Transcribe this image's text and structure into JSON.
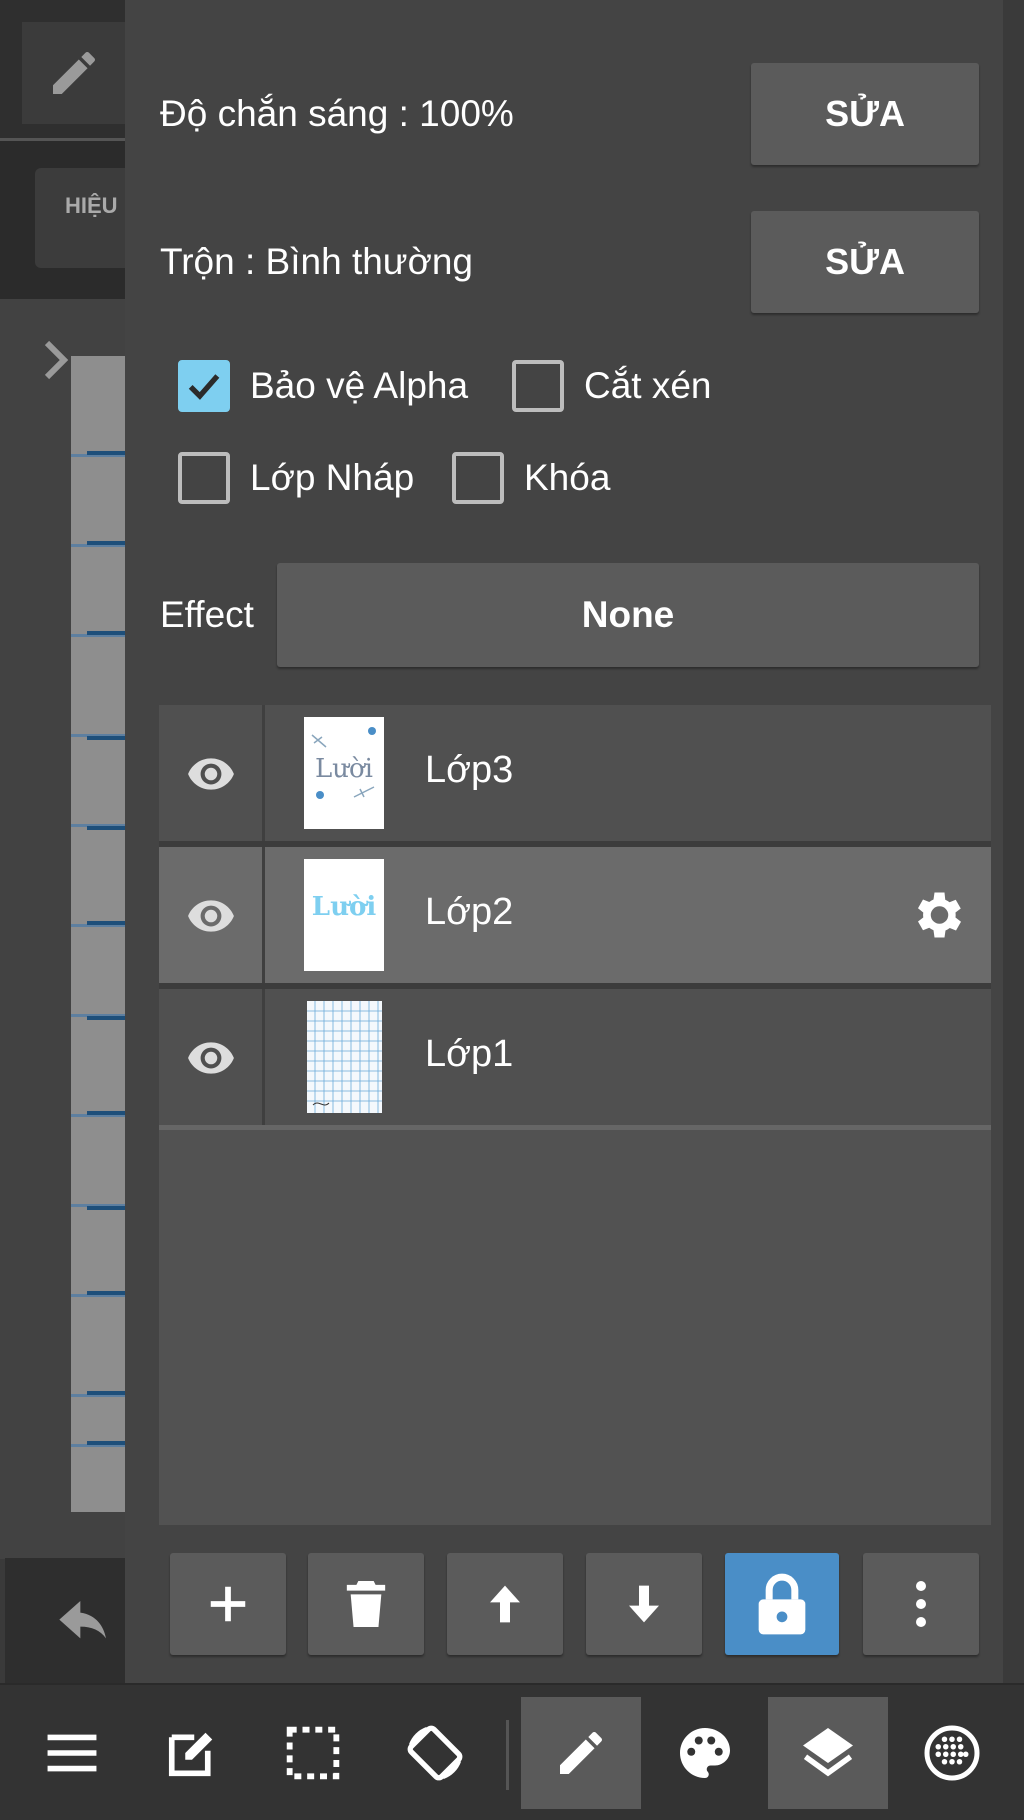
{
  "background": {
    "hieu_label": "HIỆU"
  },
  "panel": {
    "opacity_label": "Độ chắn sáng : 100%",
    "opacity_edit": "SỬA",
    "blend_label": "Trộn : Bình thường",
    "blend_edit": "SỬA",
    "checkboxes": [
      {
        "label": "Bảo vệ Alpha",
        "checked": true
      },
      {
        "label": "Cắt xén",
        "checked": false
      },
      {
        "label": "Lớp Nháp",
        "checked": false
      },
      {
        "label": "Khóa",
        "checked": false
      }
    ],
    "effect_label": "Effect",
    "effect_value": "None"
  },
  "layers": [
    {
      "name": "Lớp3",
      "visible": true,
      "selected": false,
      "thumb_text": "Lười"
    },
    {
      "name": "Lớp2",
      "visible": true,
      "selected": true,
      "thumb_text": "Lười"
    },
    {
      "name": "Lớp1",
      "visible": true,
      "selected": false
    }
  ],
  "layer_tools": [
    "add-icon",
    "trash-icon",
    "arrow-up-icon",
    "arrow-down-icon",
    "lock-icon",
    "more-vert-icon"
  ],
  "bottom_toolbar": [
    "menu-icon",
    "edit-icon",
    "selection-icon",
    "rotate-icon",
    "brush-icon",
    "palette-icon",
    "layers-icon",
    "grid-icon"
  ],
  "colors": {
    "accent_check": "#7ecff0",
    "lock_active": "#4a8ec7"
  }
}
